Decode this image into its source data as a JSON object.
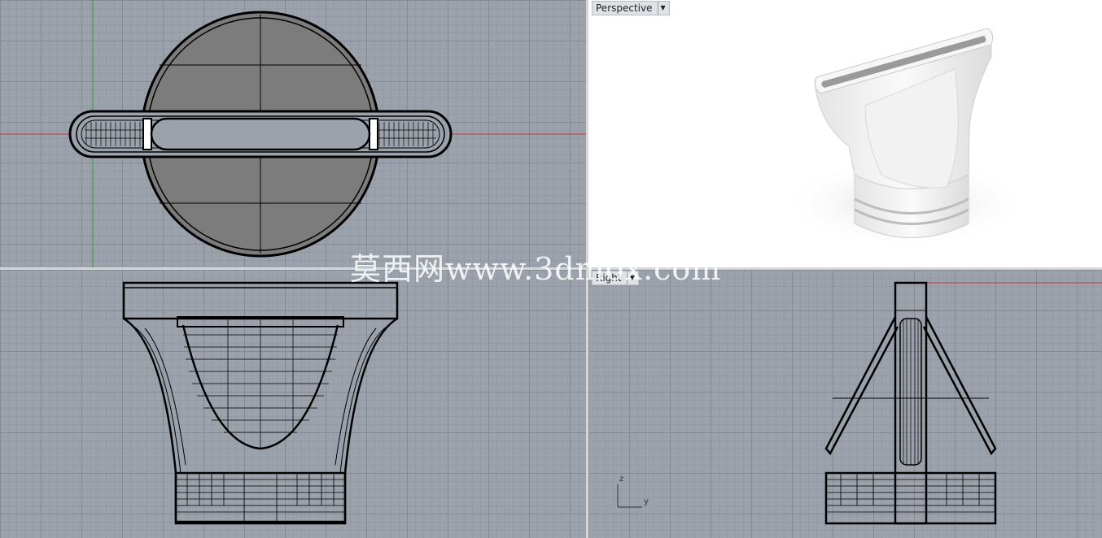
{
  "viewports": {
    "top": {
      "label": ""
    },
    "perspective": {
      "label": "Perspective"
    },
    "front": {
      "label": ""
    },
    "right": {
      "label": "Right"
    }
  },
  "axes": {
    "z": "z",
    "y": "y"
  },
  "watermark": "莫西网www.3dmox.com",
  "colors": {
    "grid_bg": "#9ba2ab",
    "x_axis": "#c0393b",
    "y_axis": "#2f9a3a",
    "wire": "#000000",
    "fill": "#7c7c7c"
  }
}
